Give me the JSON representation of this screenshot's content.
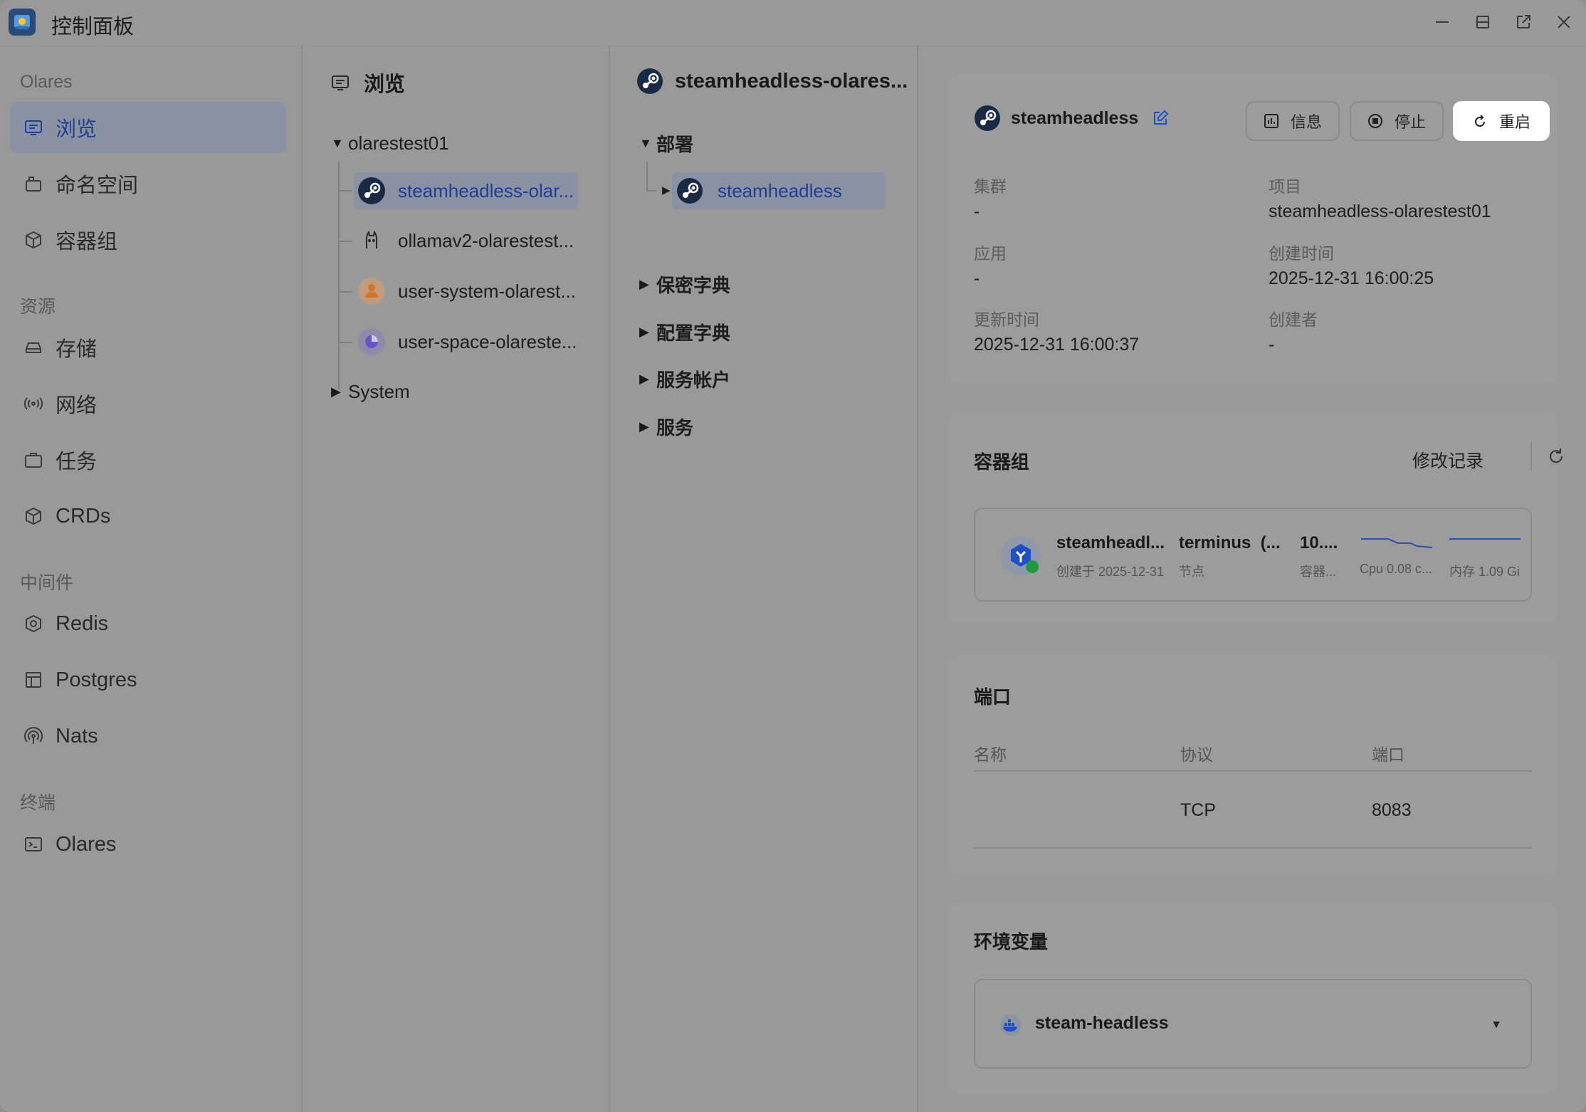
{
  "titlebar": {
    "title": "控制面板"
  },
  "sidebar": {
    "sections": [
      {
        "label": "Olares"
      },
      {
        "label": "资源"
      },
      {
        "label": "中间件"
      },
      {
        "label": "终端"
      }
    ],
    "items": [
      {
        "label": "浏览",
        "icon": "browse-icon",
        "active": true
      },
      {
        "label": "命名空间",
        "icon": "namespace-icon"
      },
      {
        "label": "容器组",
        "icon": "cube-icon"
      },
      {
        "label": "存储",
        "icon": "storage-icon"
      },
      {
        "label": "网络",
        "icon": "network-icon"
      },
      {
        "label": "任务",
        "icon": "briefcase-icon"
      },
      {
        "label": "CRDs",
        "icon": "cube-icon"
      },
      {
        "label": "Redis",
        "icon": "redis-icon"
      },
      {
        "label": "Postgres",
        "icon": "table-icon"
      },
      {
        "label": "Nats",
        "icon": "broadcast-icon"
      },
      {
        "label": "Olares",
        "icon": "terminal-icon"
      }
    ]
  },
  "browse_panel": {
    "title": "浏览",
    "root": "olarestest01",
    "namespaces": [
      {
        "label": "steamheadless-olar...",
        "active": true
      },
      {
        "label": "ollamav2-olarestest..."
      },
      {
        "label": "user-system-olarest..."
      },
      {
        "label": "user-space-olareste..."
      }
    ],
    "system": "System"
  },
  "resource_panel": {
    "title": "steamheadless-olares...",
    "groups": {
      "deploy": "部署",
      "deploy_child": "steamheadless",
      "secret": "保密字典",
      "configmap": "配置字典",
      "serviceaccount": "服务帐户",
      "service": "服务"
    }
  },
  "detail": {
    "name": "steamheadless",
    "buttons": {
      "info": "信息",
      "stop": "停止",
      "restart": "重启"
    },
    "fields": {
      "cluster_label": "集群",
      "cluster_value": "-",
      "project_label": "项目",
      "project_value": "steamheadless-olarestest01",
      "app_label": "应用",
      "app_value": "-",
      "created_label": "创建时间",
      "created_value": "2025-12-31 16:00:25",
      "updated_label": "更新时间",
      "updated_value": "2025-12-31 16:00:37",
      "creator_label": "创建者",
      "creator_value": "-"
    },
    "pods": {
      "title": "容器组",
      "history": "修改记录",
      "pod_name": "steamheadl...",
      "pod_created": "创建于 2025-12-31",
      "node_value": "terminus  (...",
      "node_label": "节点",
      "ip_value": "10....",
      "ip_label": "容器...",
      "cpu_label": "Cpu 0.08 c...",
      "mem_label": "内存 1.09 Gi"
    },
    "ports": {
      "title": "端口",
      "headers": {
        "name": "名称",
        "protocol": "协议",
        "port": "端口"
      },
      "rows": [
        {
          "name": "",
          "protocol": "TCP",
          "port": "8083"
        }
      ]
    },
    "env": {
      "title": "环境变量",
      "container": "steam-headless"
    }
  },
  "colors": {
    "accent": "#1f3f93",
    "active_bg": "#8a91a3",
    "window_bg": "#999999"
  }
}
